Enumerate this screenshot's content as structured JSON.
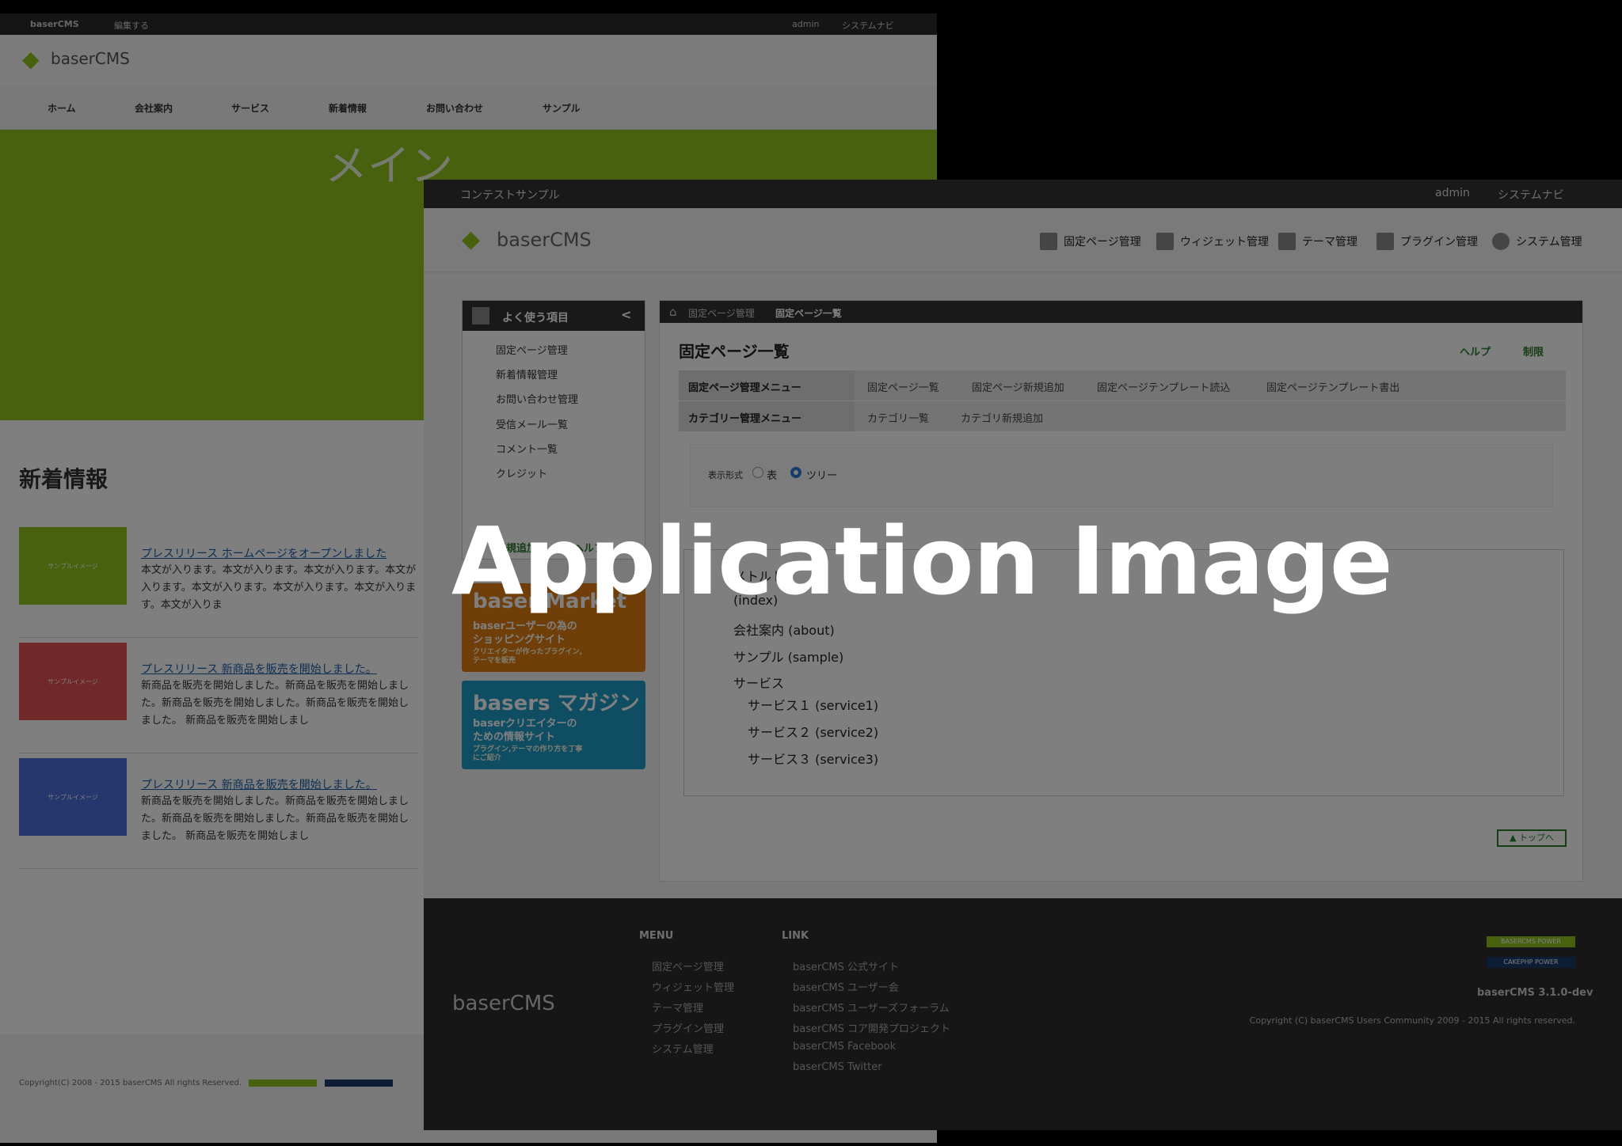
{
  "front": {
    "topbar": {
      "logo": "baserCMS",
      "edit": "編集する",
      "user": "admin",
      "system": "システムナビ"
    },
    "logo": "baserCMS",
    "nav": [
      "ホーム",
      "会社案内",
      "サービス",
      "新着情報",
      "お問い合わせ",
      "サンプル"
    ],
    "hero_text": "メイン",
    "news_title": "新着情報",
    "news": [
      {
        "thumb": "サンプルイメージ",
        "title": "プレスリリース ホームページをオープンしました",
        "body": "本文が入ります。本文が入ります。本文が入ります。本文が入ります。本文が入ります。本文が入ります。本文が入ります。本文が入りま",
        "color": "#8fc31f"
      },
      {
        "thumb": "サンプルイメージ",
        "title": "プレスリリース 新商品を販売を開始しました。",
        "body": "新商品を販売を開始しました。新商品を販売を開始しました。新商品を販売を開始しました。新商品を販売を開始しました。 新商品を販売を開始しまし",
        "color": "#e05050"
      },
      {
        "thumb": "サンプルイメージ",
        "title": "プレスリリース 新商品を販売を開始しました。",
        "body": "新商品を販売を開始しました。新商品を販売を開始しました。新商品を販売を開始しました。新商品を販売を開始しました。 新商品を販売を開始しまし",
        "color": "#4a6fd8"
      }
    ],
    "copyright": "Copyright(C) 2008 - 2015 baserCMS All rights Reserved."
  },
  "back": {
    "topbar": {
      "site": "コンテストサンプル",
      "user": "admin",
      "system": "システムナビ"
    },
    "logo": "baserCMS",
    "header_menu": [
      "固定ページ管理",
      "ウィジェット管理",
      "テーマ管理",
      "プラグイン管理",
      "システム管理"
    ],
    "sidebar": {
      "title": "よく使う項目",
      "collapse": "<",
      "items": [
        "固定ページ管理",
        "新着情報管理",
        "お問い合わせ管理",
        "受信メール一覧",
        "コメント一覧",
        "クレジット"
      ],
      "new_add": "新規追加",
      "help": "ヘルプ",
      "banner1_title": "baser Market",
      "banner1_sub": "baserユーザーの為のショッピングサイト",
      "banner1_sub2": "クリエイターが作ったプラグイン,テーマを販売",
      "banner2_title": "basers マガジン",
      "banner2_sub": "baserクリエイターのための情報サイト",
      "banner2_sub2": "プラグイン,テーマの作り方を丁寧にご紹介"
    },
    "breadcrumb": {
      "home": "⌂",
      "parent": "固定ページ管理",
      "current": "固定ページ一覧"
    },
    "page_title": "固定ページ一覧",
    "help": "ヘルプ",
    "limit": "制限",
    "menu_rows": [
      {
        "label": "固定ページ管理メニュー",
        "links": [
          "固定ページ一覧",
          "固定ページ新規追加",
          "固定ページテンプレート読込",
          "固定ページテンプレート書出"
        ]
      },
      {
        "label": "カテゴリー管理メニュー",
        "links": [
          "カテゴリ一覧",
          "カテゴリ新規追加"
        ]
      }
    ],
    "display": {
      "label": "表示形式",
      "opt1": "表",
      "opt2": "ツリー"
    },
    "tree": [
      "メトルト",
      "(index)",
      "会社案内 (about)",
      "サンプル (sample)",
      "サービス",
      "サービス１ (service1)",
      "サービス２ (service2)",
      "サービス３ (service3)"
    ],
    "to_top": "▲ トップへ",
    "footer": {
      "logo": "baserCMS",
      "menu_title": "MENU",
      "menu": [
        "固定ページ管理",
        "ウィジェット管理",
        "テーマ管理",
        "プラグイン管理",
        "システム管理"
      ],
      "link_title": "LINK",
      "links": [
        "baserCMS 公式サイト",
        "baserCMS ユーザー会",
        "baserCMS ユーザーズフォーラム",
        "baserCMS コア開発プロジェクト",
        "baserCMS Facebook",
        "baserCMS Twitter"
      ],
      "version": "baserCMS 3.1.0-dev",
      "copyright": "Copyright (C) baserCMS Users Community 2009 - 2015 All rights reserved.",
      "badge1": "BASERCMS POWER",
      "badge2": "CAKEPHP POWER"
    }
  },
  "overlay_text": "Application Image"
}
